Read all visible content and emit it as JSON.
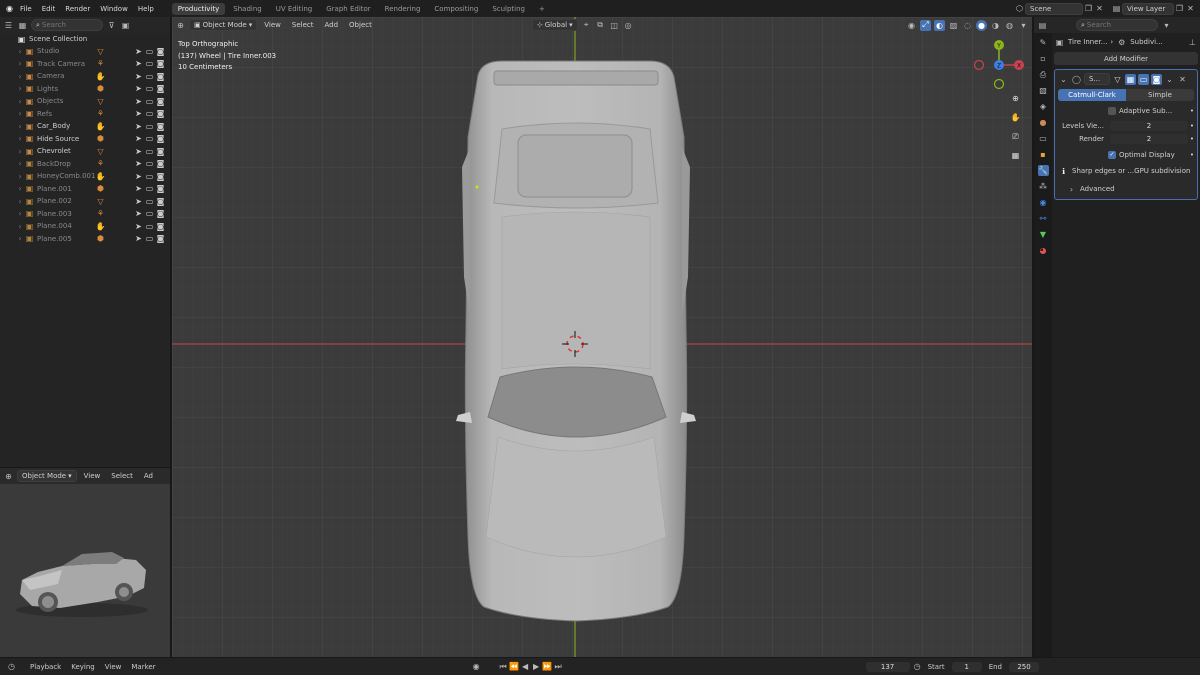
{
  "topbar": {
    "menus": [
      "File",
      "Edit",
      "Render",
      "Window",
      "Help"
    ],
    "workspaces": [
      "Productivity",
      "Shading",
      "UV Editing",
      "Graph Editor",
      "Rendering",
      "Compositing",
      "Sculpting"
    ],
    "add_workspace": "+",
    "scene": "Scene",
    "view_layer": "View Layer"
  },
  "outliner": {
    "search_placeholder": "Search",
    "root": "Scene Collection",
    "items": [
      {
        "name": "Studio",
        "dim": true
      },
      {
        "name": "Track Camera",
        "dim": true
      },
      {
        "name": "Camera",
        "dim": true
      },
      {
        "name": "Lights",
        "dim": true
      },
      {
        "name": "Objects",
        "dim": true
      },
      {
        "name": "Refs",
        "dim": true
      },
      {
        "name": "Car_Body",
        "dim": false
      },
      {
        "name": "Hide Source",
        "dim": false
      },
      {
        "name": "Chevrolet",
        "dim": false
      },
      {
        "name": "BackDrop",
        "dim": true
      },
      {
        "name": "HoneyComb.001",
        "dim": true
      },
      {
        "name": "Plane.001",
        "dim": true
      },
      {
        "name": "Plane.002",
        "dim": true
      },
      {
        "name": "Plane.003",
        "dim": true
      },
      {
        "name": "Plane.004",
        "dim": true
      },
      {
        "name": "Plane.005",
        "dim": true
      }
    ]
  },
  "mini_view": {
    "mode": "Object Mode",
    "menus": [
      "View",
      "Select",
      "Ad"
    ]
  },
  "viewport": {
    "mode": "Object Mode",
    "menus": [
      "View",
      "Select",
      "Add",
      "Object"
    ],
    "transform": "Global",
    "info_line1": "Top Orthographic",
    "info_line2": "(137) Wheel | Tire Inner.003",
    "info_line3": "10 Centimeters",
    "gizmo": {
      "y": "Y",
      "x": "X",
      "z": "Z"
    }
  },
  "properties": {
    "search_placeholder": "Search",
    "breadcrumb_obj": "Tire Inner...",
    "breadcrumb_mod": "Subdivi...",
    "add_modifier": "Add Modifier",
    "mod_name": "S...",
    "tab_catmull": "Catmull-Clark",
    "tab_simple": "Simple",
    "adaptive": "Adaptive Sub...",
    "levels_label": "Levels Vie...",
    "levels_value": "2",
    "render_label": "Render",
    "render_value": "2",
    "optimal": "Optimal Display",
    "info": "Sharp edges or ...GPU subdivision",
    "advanced": "Advanced"
  },
  "timeline": {
    "menus": [
      "Playback",
      "Keying",
      "View",
      "Marker"
    ],
    "frame": "137",
    "start_label": "Start",
    "start": "1",
    "end_label": "End",
    "end": "250"
  },
  "colors": {
    "accent": "#4772b3",
    "x_axis": "#c8434e",
    "y_axis": "#8db51b",
    "z_axis": "#3d7fe6"
  }
}
